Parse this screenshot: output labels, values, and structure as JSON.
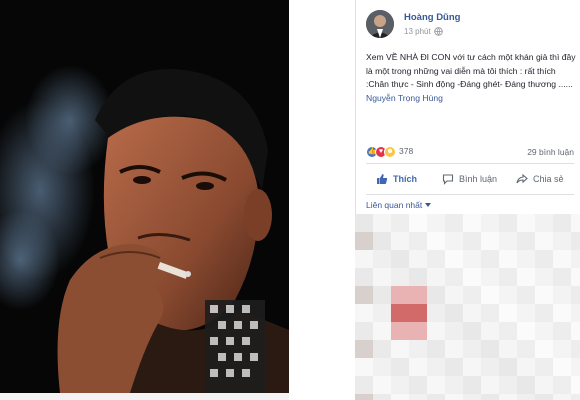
{
  "post": {
    "author": "Hoàng Dũng",
    "time": "13 phút",
    "text": "Xem VỀ NHÀ ĐI CON với tư cách một khán giả thì đây là một trong những vai diễn mà tôi thích : rất thích :Chân thực - Sinh động -Đáng ghét- Đáng thương ......",
    "tag": "Nguyễn Trọng Hùng",
    "reaction_count": "378",
    "comment_count": "29 bình luận"
  },
  "actions": {
    "like": "Thích",
    "comment": "Bình luận",
    "share": "Chia sẻ"
  },
  "comments": {
    "sort_label": "Liên quan nhất"
  },
  "colors": {
    "link": "#385898",
    "like_blue": "#4267b2",
    "love": "#e8304b",
    "haha": "#f7c64a"
  },
  "icons": [
    "globe-icon",
    "like-reaction-icon",
    "love-reaction-icon",
    "haha-reaction-icon",
    "thumbs-up-icon",
    "comment-icon",
    "share-icon",
    "caret-down-icon"
  ]
}
